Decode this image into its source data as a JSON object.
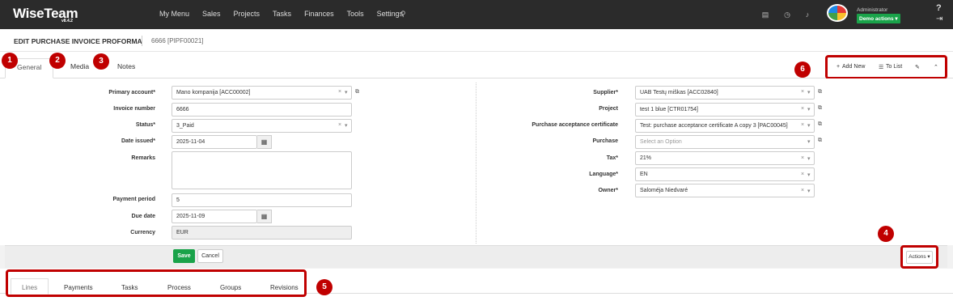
{
  "app": {
    "name": "WiseTeam",
    "version": "v8.4.2"
  },
  "nav": {
    "items": [
      "My Menu",
      "Sales",
      "Projects",
      "Tasks",
      "Finances",
      "Tools",
      "Settings"
    ]
  },
  "user": {
    "name": "Administrator",
    "demo_label": "Demo actions ▾"
  },
  "page": {
    "title": "EDIT PURCHASE INVOICE PROFORMA",
    "subtitle": "6666 [PIPF00021]"
  },
  "tabs": [
    {
      "label": "General",
      "active": true
    },
    {
      "label": "Media",
      "active": false
    },
    {
      "label": "Notes",
      "active": false
    }
  ],
  "toolbar": {
    "add_new": "Add New",
    "to_list": "To List"
  },
  "form_left": {
    "primary_account": {
      "label": "Primary account*",
      "value": "Mano kompanija [ACC00002]"
    },
    "invoice_number": {
      "label": "Invoice number",
      "value": "6666"
    },
    "status": {
      "label": "Status*",
      "value": "3_Paid"
    },
    "date_issued": {
      "label": "Date issued*",
      "value": "2025-11-04"
    },
    "remarks": {
      "label": "Remarks",
      "value": ""
    },
    "payment_period": {
      "label": "Payment period",
      "value": "5"
    },
    "due_date": {
      "label": "Due date",
      "value": "2025-11-09"
    },
    "currency": {
      "label": "Currency",
      "value": "EUR"
    }
  },
  "form_right": {
    "supplier": {
      "label": "Supplier*",
      "value": "UAB Testų miškas [ACC02840]"
    },
    "project": {
      "label": "Project",
      "value": "test 1 blue [CTR01754]"
    },
    "pac": {
      "label": "Purchase acceptance certificate",
      "value": "Test: purchase acceptance certificate A copy 3 [PAC00045]"
    },
    "purchase": {
      "label": "Purchase",
      "placeholder": "Select an Option"
    },
    "tax": {
      "label": "Tax*",
      "value": "21%"
    },
    "language": {
      "label": "Language*",
      "value": "EN"
    },
    "owner": {
      "label": "Owner*",
      "value": "Saloméja Niedvaré"
    }
  },
  "buttons": {
    "save": "Save",
    "cancel": "Cancel",
    "actions": "Actions ▾"
  },
  "bottom_tabs": [
    {
      "label": "Lines",
      "active": true
    },
    {
      "label": "Payments",
      "active": false
    },
    {
      "label": "Tasks",
      "active": false
    },
    {
      "label": "Process",
      "active": false
    },
    {
      "label": "Groups",
      "active": false
    },
    {
      "label": "Revisions",
      "active": false
    }
  ],
  "badges": [
    "1",
    "2",
    "3",
    "4",
    "5",
    "6"
  ],
  "colors": {
    "topbar": "#2b2b2b",
    "accent_green": "#1aa34a",
    "highlight_red": "#c00000"
  }
}
